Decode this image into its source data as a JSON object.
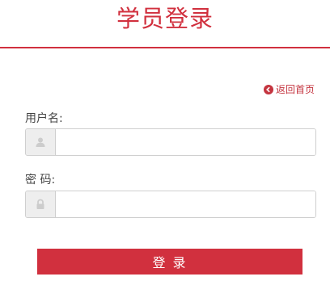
{
  "header": {
    "title": "学员登录"
  },
  "nav": {
    "back_label": "返回首页",
    "back_icon": "arrow-left-circle-icon"
  },
  "form": {
    "username_label": "用户名:",
    "username_value": "",
    "username_icon": "user-icon",
    "password_label": "密 码:",
    "password_value": "",
    "password_icon": "lock-icon",
    "submit_label": "登 录"
  },
  "colors": {
    "accent": "#d1303e",
    "addon_bg": "#eeeeee",
    "border": "#cfcfcf"
  }
}
